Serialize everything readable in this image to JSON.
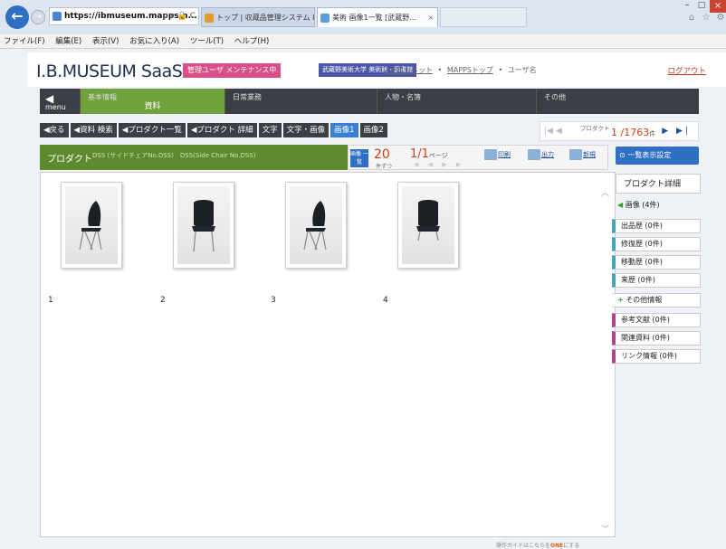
{
  "browser": {
    "url_display_bold": "https://ibmuseum.mapps.n...",
    "address_controls": "ρ ▾ 🔒 C",
    "tab1_title": "トップ | 収蔵品管理システム I.B....",
    "tab2_title": "美術 画像1一覧 [武蔵野...",
    "tab2_close": "×",
    "min": "–",
    "max": "□",
    "close": "×"
  },
  "menubar": [
    "ファイル(F)",
    "編集(E)",
    "表示(V)",
    "お気に入り(A)",
    "ツール(T)",
    "ヘルプ(H)"
  ],
  "header": {
    "logo": "I.B.MUSEUM SaaS",
    "badge": "管理ユーザ メンテナンス中",
    "institution": "武蔵野美術大学 美術館・図書館",
    "links": [
      "フォローネット",
      "MAPPSトップ",
      "ユーザ名"
    ],
    "logout": "ログアウト"
  },
  "nav": {
    "menu": "menu",
    "items": [
      {
        "label": "基本情報",
        "sub": "資料",
        "active": true
      },
      {
        "label": "日常業務",
        "sub": ""
      },
      {
        "label": "人物・名簿",
        "sub": ""
      },
      {
        "label": "その他",
        "sub": ""
      }
    ]
  },
  "breadcrumb": [
    "◀戻る",
    "◀資料 検索",
    "◀プロダクト一覧",
    "◀プロダクト 詳細",
    "文字",
    "文字・画像",
    "画像1",
    "画像2"
  ],
  "pager": {
    "prefix": "|◀ ◀",
    "label": "プロダクト",
    "current": "1",
    "total": "/1763",
    "unit": "件",
    "next": "▶ ▶|"
  },
  "titlebar": {
    "label": "プロダクト",
    "item": "DSS (サイドチェアNo.DSS)　DSS(Side Chair No.DSS)"
  },
  "controls": {
    "image_list": "画像 一覧",
    "per": "20",
    "per_unit": "件ずつ",
    "page": "1/1",
    "page_unit": "ページ",
    "page_nav": "◀ ◀ ▶ ▶",
    "print": "印刷",
    "export": "出力",
    "new": "新規"
  },
  "display_settings": "一覧表示設定",
  "images": [
    {
      "num": "1",
      "pose": "side"
    },
    {
      "num": "2",
      "pose": "back"
    },
    {
      "num": "3",
      "pose": "side"
    },
    {
      "num": "4",
      "pose": "back"
    }
  ],
  "sidebar": {
    "title": "プロダクト詳細",
    "items": [
      {
        "label": "画像 (4件)",
        "kind": "sel",
        "icon": "◀"
      },
      {
        "label": "出品歴 (0件)"
      },
      {
        "label": "修復歴 (0件)"
      },
      {
        "label": "移動歴 (0件)"
      },
      {
        "label": "来歴 (0件)"
      },
      {
        "label": "その他情報",
        "kind": "other",
        "icon": "+"
      },
      {
        "label": "参考文献 (0件)",
        "kind": "ref"
      },
      {
        "label": "関連資料 (0件)",
        "kind": "ref"
      },
      {
        "label": "リンク情報 (0件)",
        "kind": "ref"
      }
    ]
  },
  "footer_note": {
    "text": "操作ガイドはこちらを",
    "emph": "ONE",
    "tail": "にする"
  }
}
